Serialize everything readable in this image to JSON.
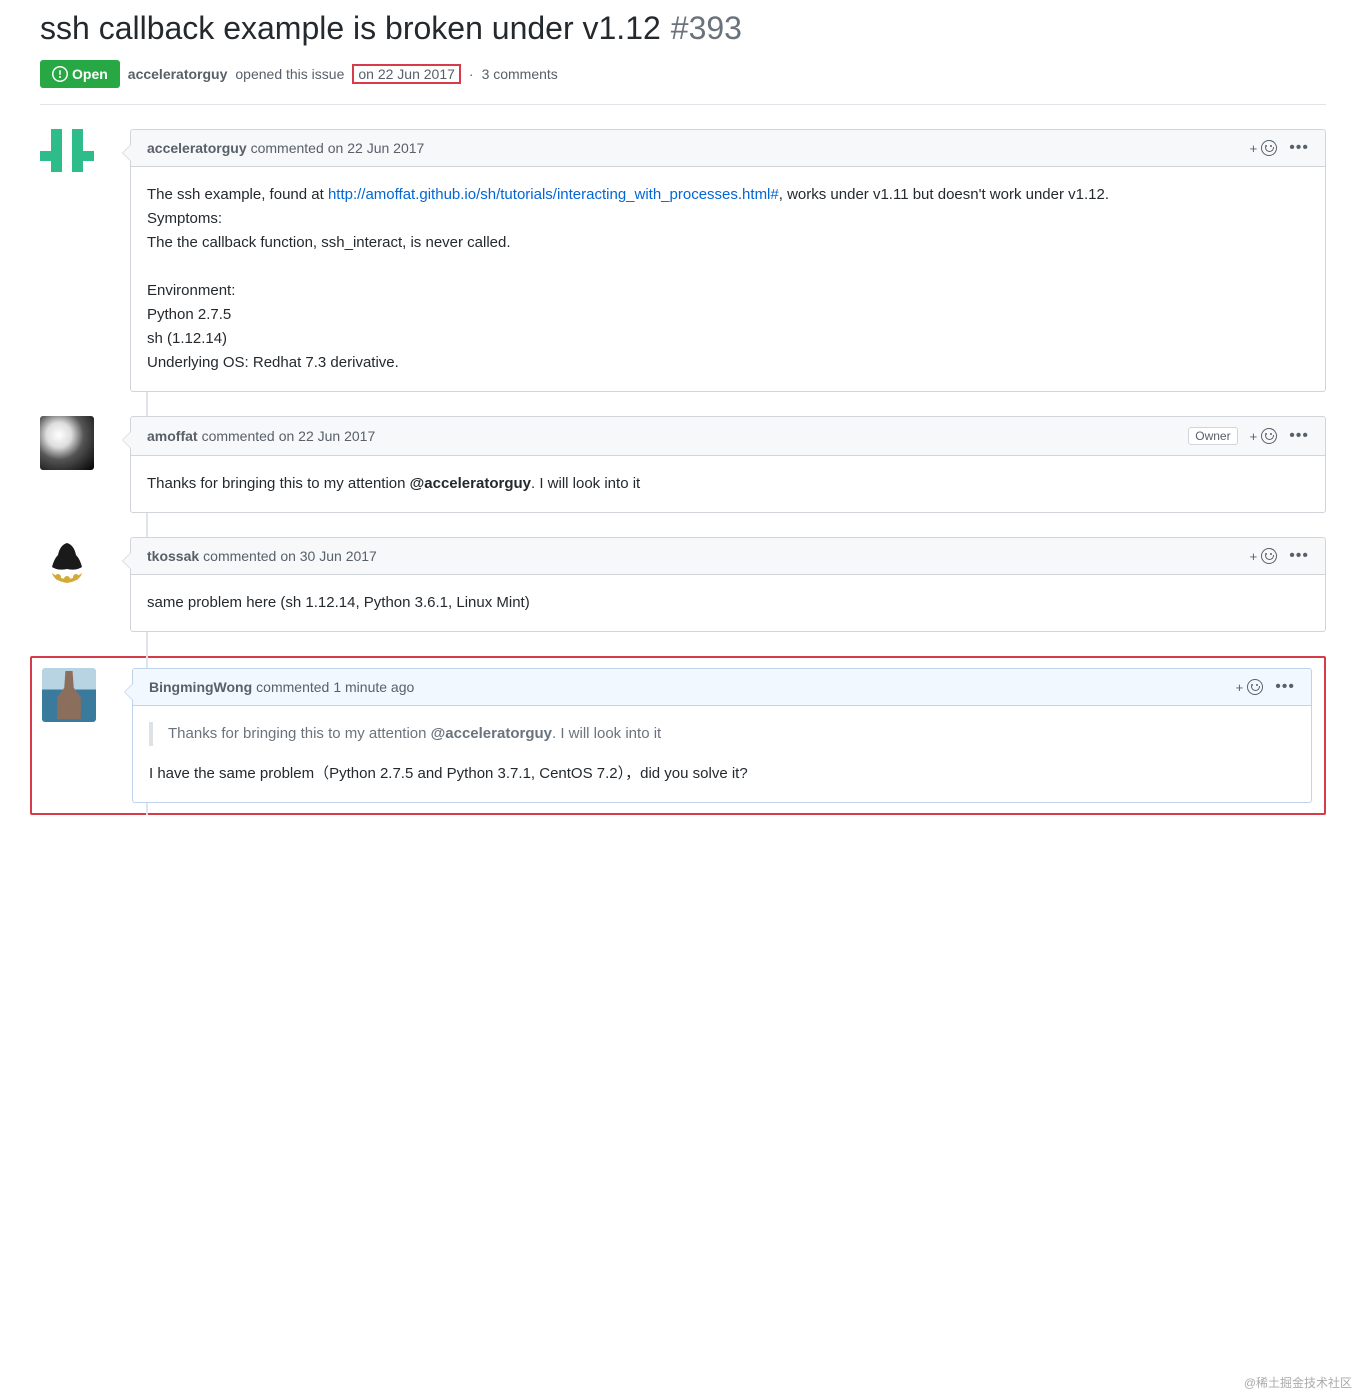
{
  "issue": {
    "title": "ssh callback example is broken under v1.12",
    "number": "#393",
    "state": "Open",
    "author": "acceleratorguy",
    "opened_text": "opened this issue",
    "date": "on 22 Jun 2017",
    "separator": "·",
    "comments_count": "3 comments"
  },
  "comments": [
    {
      "author": "acceleratorguy",
      "verb": "commented",
      "date": "on 22 Jun 2017",
      "role": "",
      "body_pre": "The ssh example, found at ",
      "body_link": "http://amoffat.github.io/sh/tutorials/interacting_with_processes.html#",
      "body_post": ", works under v1.11 but doesn't work under v1.12.",
      "line2": "Symptoms:",
      "line3": "The the callback function, ssh_interact, is never called.",
      "line4": "",
      "line5": "Environment:",
      "line6": "Python 2.7.5",
      "line7": "sh (1.12.14)",
      "line8": "Underlying OS: Redhat 7.3 derivative."
    },
    {
      "author": "amoffat",
      "verb": "commented",
      "date": "on 22 Jun 2017",
      "role": "Owner",
      "body_pre": "Thanks for bringing this to my attention ",
      "mention": "@acceleratorguy",
      "body_post": ". I will look into it"
    },
    {
      "author": "tkossak",
      "verb": "commented",
      "date": "on 30 Jun 2017",
      "role": "",
      "body": "same problem here (sh 1.12.14, Python 3.6.1, Linux Mint)"
    },
    {
      "author": "BingmingWong",
      "verb": "commented",
      "date": "1 minute ago",
      "role": "",
      "quote_pre": "Thanks for bringing this to my attention ",
      "quote_mention": "@acceleratorguy",
      "quote_post": ". I will look into it",
      "body": "I have the same problem（Python 2.7.5 and Python 3.7.1, CentOS 7.2），did you solve it?"
    }
  ],
  "watermark": "@稀土掘金技术社区"
}
